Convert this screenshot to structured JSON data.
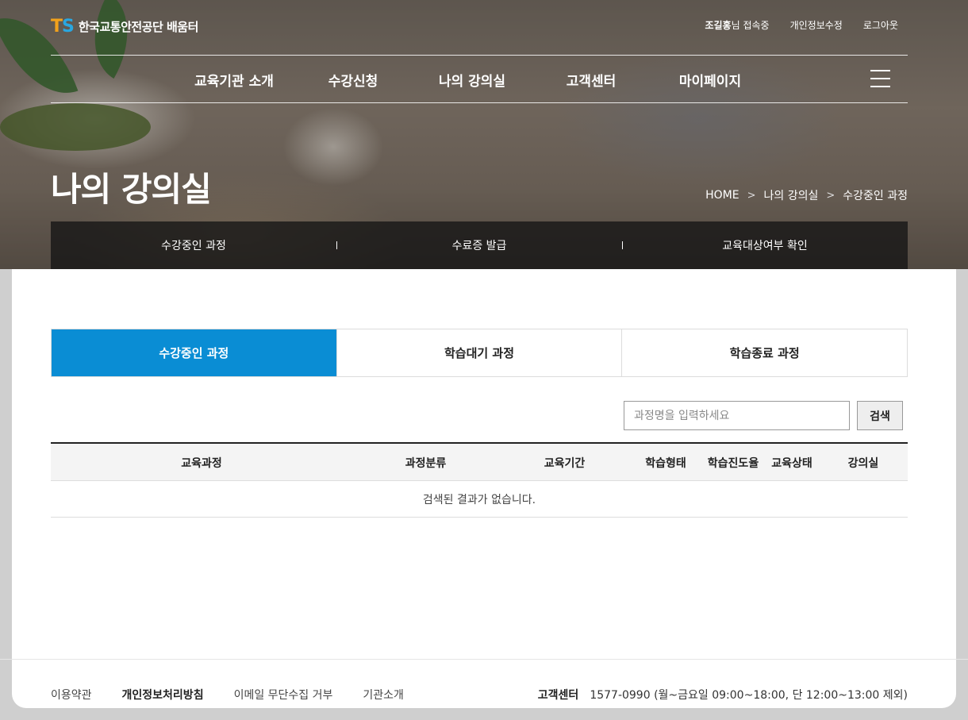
{
  "header": {
    "logo_mark_t": "T",
    "logo_mark_s": "S",
    "logo_text": "한국교통안전공단 배움터",
    "util": {
      "user_name": "조길홍",
      "user_suffix": "님 접속중",
      "edit_info": "개인정보수정",
      "logout": "로그아웃"
    },
    "gnb": [
      "교육기관 소개",
      "수강신청",
      "나의 강의실",
      "고객센터",
      "마이페이지"
    ]
  },
  "hero": {
    "title": "나의 강의실",
    "breadcrumb": [
      "HOME",
      "나의 강의실",
      "수강중인 과정"
    ],
    "breadcrumb_sep": ">",
    "subnav": [
      "수강중인 과정",
      "수료증 발급",
      "교육대상여부 확인"
    ]
  },
  "tabs": [
    "수강중인 과정",
    "학습대기 과정",
    "학습종료 과정"
  ],
  "active_tab": 0,
  "search": {
    "placeholder": "과정명을 입력하세요",
    "button": "검색"
  },
  "table": {
    "columns": [
      "교육과정",
      "과정분류",
      "교육기간",
      "학습형태",
      "학습진도율",
      "교육상태",
      "강의실"
    ],
    "empty_message": "검색된 결과가 없습니다."
  },
  "footer": {
    "links": [
      "이용약관",
      "개인정보처리방침",
      "이메일 무단수집 거부",
      "기관소개"
    ],
    "cs_label": "고객센터",
    "cs_phone": "1577-0990",
    "cs_hours": "(월~금요일 09:00~18:00, 단 12:00~13:00 제외)"
  },
  "colors": {
    "accent": "#0a8dd4",
    "logo_t": "#f2a21b",
    "logo_s": "#2aa7e0"
  }
}
